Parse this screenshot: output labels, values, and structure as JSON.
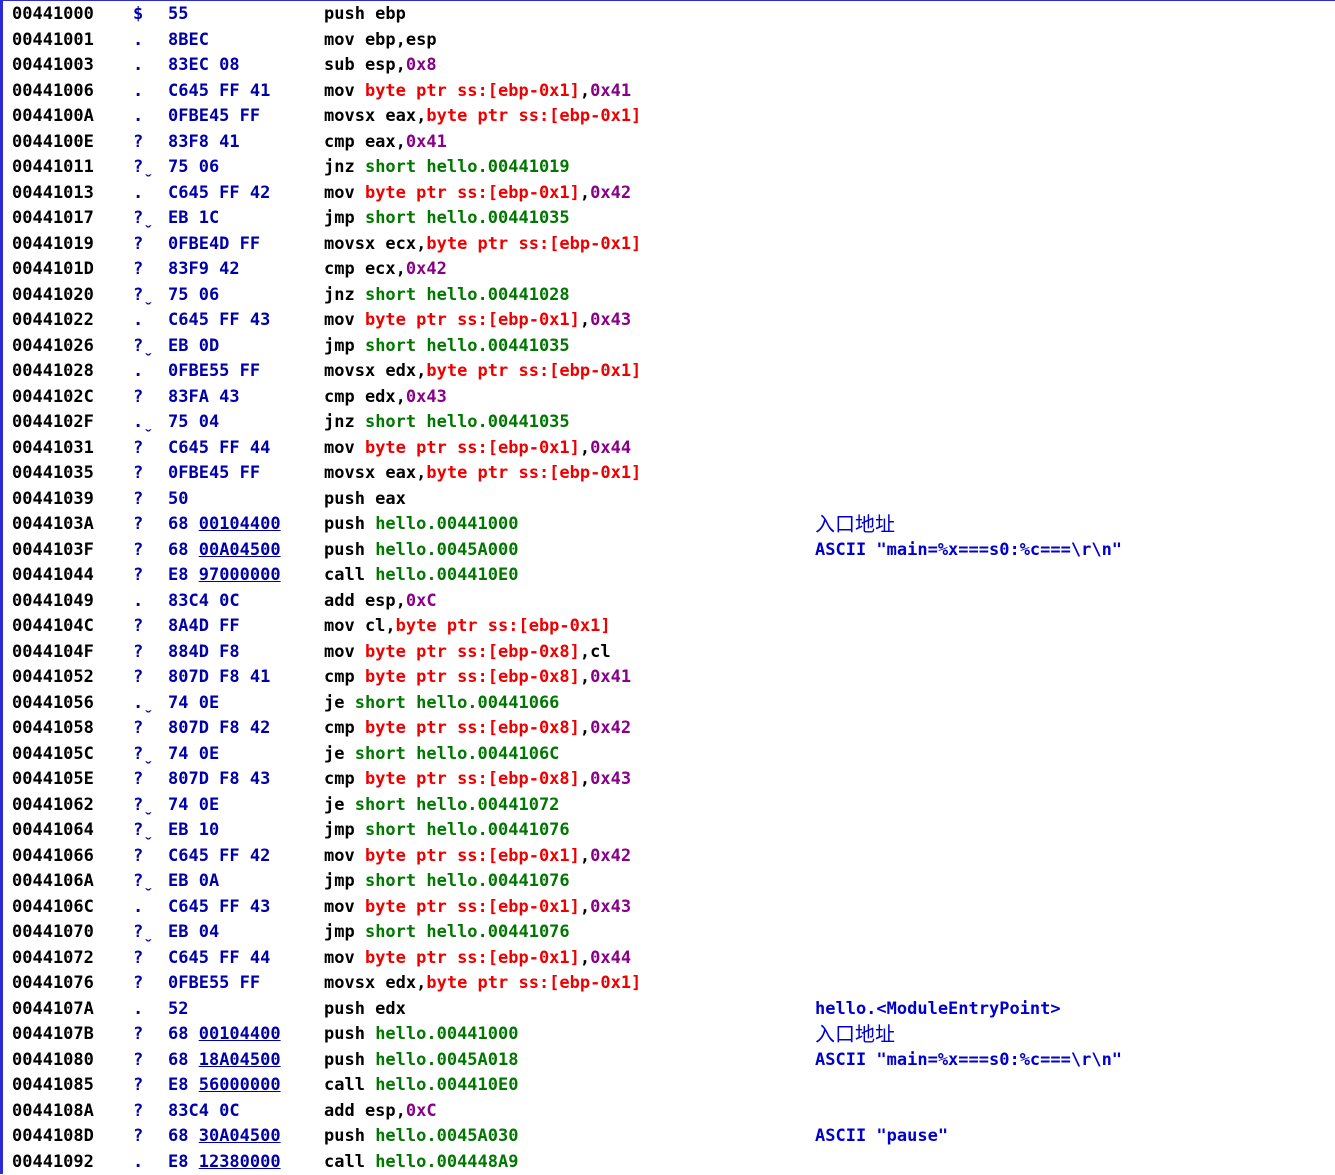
{
  "colors": {
    "address": "#000000",
    "marker": "#0000aa",
    "hex": "#0000aa",
    "mnemonic": "#000000",
    "memory_operand": "#ee0000",
    "immediate": "#880088",
    "jump_target": "#007700",
    "comment": "#0000cc",
    "border": "#2a2ad8"
  },
  "rows": [
    {
      "addr": "00441000",
      "mark": "$",
      "hex": [
        {
          "t": "55"
        }
      ],
      "instr": [
        {
          "t": "push ebp",
          "c": "black"
        }
      ],
      "cmt": ""
    },
    {
      "addr": "00441001",
      "mark": ".",
      "hex": [
        {
          "t": "8BEC"
        }
      ],
      "instr": [
        {
          "t": "mov ebp,esp",
          "c": "black"
        }
      ],
      "cmt": ""
    },
    {
      "addr": "00441003",
      "mark": ".",
      "hex": [
        {
          "t": "83EC 08"
        }
      ],
      "instr": [
        {
          "t": "sub esp,",
          "c": "black"
        },
        {
          "t": "0x8",
          "c": "purple"
        }
      ],
      "cmt": ""
    },
    {
      "addr": "00441006",
      "mark": ".",
      "hex": [
        {
          "t": "C645 FF 41"
        }
      ],
      "instr": [
        {
          "t": "mov ",
          "c": "black"
        },
        {
          "t": "byte ptr ss:[ebp-0x1]",
          "c": "red"
        },
        {
          "t": ",",
          "c": "black"
        },
        {
          "t": "0x41",
          "c": "purple"
        }
      ],
      "cmt": ""
    },
    {
      "addr": "0044100A",
      "mark": ".",
      "hex": [
        {
          "t": "0FBE45 FF"
        }
      ],
      "instr": [
        {
          "t": "movsx eax,",
          "c": "black"
        },
        {
          "t": "byte ptr ss:[ebp-0x1]",
          "c": "red"
        }
      ],
      "cmt": ""
    },
    {
      "addr": "0044100E",
      "mark": "?",
      "hex": [
        {
          "t": "83F8 41"
        }
      ],
      "instr": [
        {
          "t": "cmp eax,",
          "c": "black"
        },
        {
          "t": "0x41",
          "c": "purple"
        }
      ],
      "cmt": ""
    },
    {
      "addr": "00441011",
      "mark": "?ˬ",
      "hex": [
        {
          "t": "75 06"
        }
      ],
      "instr": [
        {
          "t": "jnz ",
          "c": "black"
        },
        {
          "t": "short hello.00441019",
          "c": "green"
        }
      ],
      "cmt": ""
    },
    {
      "addr": "00441013",
      "mark": ".",
      "hex": [
        {
          "t": "C645 FF 42"
        }
      ],
      "instr": [
        {
          "t": "mov ",
          "c": "black"
        },
        {
          "t": "byte ptr ss:[ebp-0x1]",
          "c": "red"
        },
        {
          "t": ",",
          "c": "black"
        },
        {
          "t": "0x42",
          "c": "purple"
        }
      ],
      "cmt": ""
    },
    {
      "addr": "00441017",
      "mark": "?ˬ",
      "hex": [
        {
          "t": "EB 1C"
        }
      ],
      "instr": [
        {
          "t": "jmp ",
          "c": "black"
        },
        {
          "t": "short hello.00441035",
          "c": "green"
        }
      ],
      "cmt": ""
    },
    {
      "addr": "00441019",
      "mark": "?",
      "hex": [
        {
          "t": "0FBE4D FF"
        }
      ],
      "instr": [
        {
          "t": "movsx ecx,",
          "c": "black"
        },
        {
          "t": "byte ptr ss:[ebp-0x1]",
          "c": "red"
        }
      ],
      "cmt": ""
    },
    {
      "addr": "0044101D",
      "mark": "?",
      "hex": [
        {
          "t": "83F9 42"
        }
      ],
      "instr": [
        {
          "t": "cmp ecx,",
          "c": "black"
        },
        {
          "t": "0x42",
          "c": "purple"
        }
      ],
      "cmt": ""
    },
    {
      "addr": "00441020",
      "mark": "?ˬ",
      "hex": [
        {
          "t": "75 06"
        }
      ],
      "instr": [
        {
          "t": "jnz ",
          "c": "black"
        },
        {
          "t": "short hello.00441028",
          "c": "green"
        }
      ],
      "cmt": ""
    },
    {
      "addr": "00441022",
      "mark": ".",
      "hex": [
        {
          "t": "C645 FF 43"
        }
      ],
      "instr": [
        {
          "t": "mov ",
          "c": "black"
        },
        {
          "t": "byte ptr ss:[ebp-0x1]",
          "c": "red"
        },
        {
          "t": ",",
          "c": "black"
        },
        {
          "t": "0x43",
          "c": "purple"
        }
      ],
      "cmt": ""
    },
    {
      "addr": "00441026",
      "mark": "?ˬ",
      "hex": [
        {
          "t": "EB 0D"
        }
      ],
      "instr": [
        {
          "t": "jmp ",
          "c": "black"
        },
        {
          "t": "short hello.00441035",
          "c": "green"
        }
      ],
      "cmt": ""
    },
    {
      "addr": "00441028",
      "mark": ".",
      "hex": [
        {
          "t": "0FBE55 FF"
        }
      ],
      "instr": [
        {
          "t": "movsx edx,",
          "c": "black"
        },
        {
          "t": "byte ptr ss:[ebp-0x1]",
          "c": "red"
        }
      ],
      "cmt": ""
    },
    {
      "addr": "0044102C",
      "mark": "?",
      "hex": [
        {
          "t": "83FA 43"
        }
      ],
      "instr": [
        {
          "t": "cmp edx,",
          "c": "black"
        },
        {
          "t": "0x43",
          "c": "purple"
        }
      ],
      "cmt": ""
    },
    {
      "addr": "0044102F",
      "mark": ".ˬ",
      "hex": [
        {
          "t": "75 04"
        }
      ],
      "instr": [
        {
          "t": "jnz ",
          "c": "black"
        },
        {
          "t": "short hello.00441035",
          "c": "green"
        }
      ],
      "cmt": ""
    },
    {
      "addr": "00441031",
      "mark": "?",
      "hex": [
        {
          "t": "C645 FF 44"
        }
      ],
      "instr": [
        {
          "t": "mov ",
          "c": "black"
        },
        {
          "t": "byte ptr ss:[ebp-0x1]",
          "c": "red"
        },
        {
          "t": ",",
          "c": "black"
        },
        {
          "t": "0x44",
          "c": "purple"
        }
      ],
      "cmt": ""
    },
    {
      "addr": "00441035",
      "mark": "?",
      "hex": [
        {
          "t": "0FBE45 FF"
        }
      ],
      "instr": [
        {
          "t": "movsx eax,",
          "c": "black"
        },
        {
          "t": "byte ptr ss:[ebp-0x1]",
          "c": "red"
        }
      ],
      "cmt": ""
    },
    {
      "addr": "00441039",
      "mark": "?",
      "hex": [
        {
          "t": "50"
        }
      ],
      "instr": [
        {
          "t": "push eax",
          "c": "black"
        }
      ],
      "cmt": ""
    },
    {
      "addr": "0044103A",
      "mark": "?",
      "hex": [
        {
          "t": "68 "
        },
        {
          "t": "00104400",
          "u": true
        }
      ],
      "instr": [
        {
          "t": "push ",
          "c": "black"
        },
        {
          "t": "hello.00441000",
          "c": "green"
        }
      ],
      "cmt": "入口地址",
      "cjk": true
    },
    {
      "addr": "0044103F",
      "mark": "?",
      "hex": [
        {
          "t": "68 "
        },
        {
          "t": "00A04500",
          "u": true
        }
      ],
      "instr": [
        {
          "t": "push ",
          "c": "black"
        },
        {
          "t": "hello.0045A000",
          "c": "green"
        }
      ],
      "cmt": "ASCII \"main=%x===s0:%c===\\r\\n\""
    },
    {
      "addr": "00441044",
      "mark": "?",
      "hex": [
        {
          "t": "E8 "
        },
        {
          "t": "97000000",
          "u": true
        }
      ],
      "instr": [
        {
          "t": "call ",
          "c": "black"
        },
        {
          "t": "hello.004410E0",
          "c": "green"
        }
      ],
      "cmt": ""
    },
    {
      "addr": "00441049",
      "mark": ".",
      "hex": [
        {
          "t": "83C4 0C"
        }
      ],
      "instr": [
        {
          "t": "add esp,",
          "c": "black"
        },
        {
          "t": "0xC",
          "c": "purple"
        }
      ],
      "cmt": ""
    },
    {
      "addr": "0044104C",
      "mark": "?",
      "hex": [
        {
          "t": "8A4D FF"
        }
      ],
      "instr": [
        {
          "t": "mov cl,",
          "c": "black"
        },
        {
          "t": "byte ptr ss:[ebp-0x1]",
          "c": "red"
        }
      ],
      "cmt": ""
    },
    {
      "addr": "0044104F",
      "mark": "?",
      "hex": [
        {
          "t": "884D F8"
        }
      ],
      "instr": [
        {
          "t": "mov ",
          "c": "black"
        },
        {
          "t": "byte ptr ss:[ebp-0x8]",
          "c": "red"
        },
        {
          "t": ",cl",
          "c": "black"
        }
      ],
      "cmt": ""
    },
    {
      "addr": "00441052",
      "mark": "?",
      "hex": [
        {
          "t": "807D F8 41"
        }
      ],
      "instr": [
        {
          "t": "cmp ",
          "c": "black"
        },
        {
          "t": "byte ptr ss:[ebp-0x8]",
          "c": "red"
        },
        {
          "t": ",",
          "c": "black"
        },
        {
          "t": "0x41",
          "c": "purple"
        }
      ],
      "cmt": ""
    },
    {
      "addr": "00441056",
      "mark": ".ˬ",
      "hex": [
        {
          "t": "74 0E"
        }
      ],
      "instr": [
        {
          "t": "je ",
          "c": "black"
        },
        {
          "t": "short hello.00441066",
          "c": "green"
        }
      ],
      "cmt": ""
    },
    {
      "addr": "00441058",
      "mark": "?",
      "hex": [
        {
          "t": "807D F8 42"
        }
      ],
      "instr": [
        {
          "t": "cmp ",
          "c": "black"
        },
        {
          "t": "byte ptr ss:[ebp-0x8]",
          "c": "red"
        },
        {
          "t": ",",
          "c": "black"
        },
        {
          "t": "0x42",
          "c": "purple"
        }
      ],
      "cmt": ""
    },
    {
      "addr": "0044105C",
      "mark": "?ˬ",
      "hex": [
        {
          "t": "74 0E"
        }
      ],
      "instr": [
        {
          "t": "je ",
          "c": "black"
        },
        {
          "t": "short hello.0044106C",
          "c": "green"
        }
      ],
      "cmt": ""
    },
    {
      "addr": "0044105E",
      "mark": "?",
      "hex": [
        {
          "t": "807D F8 43"
        }
      ],
      "instr": [
        {
          "t": "cmp ",
          "c": "black"
        },
        {
          "t": "byte ptr ss:[ebp-0x8]",
          "c": "red"
        },
        {
          "t": ",",
          "c": "black"
        },
        {
          "t": "0x43",
          "c": "purple"
        }
      ],
      "cmt": ""
    },
    {
      "addr": "00441062",
      "mark": "?ˬ",
      "hex": [
        {
          "t": "74 0E"
        }
      ],
      "instr": [
        {
          "t": "je ",
          "c": "black"
        },
        {
          "t": "short hello.00441072",
          "c": "green"
        }
      ],
      "cmt": ""
    },
    {
      "addr": "00441064",
      "mark": "?ˬ",
      "hex": [
        {
          "t": "EB 10"
        }
      ],
      "instr": [
        {
          "t": "jmp ",
          "c": "black"
        },
        {
          "t": "short hello.00441076",
          "c": "green"
        }
      ],
      "cmt": ""
    },
    {
      "addr": "00441066",
      "mark": "?",
      "hex": [
        {
          "t": "C645 FF 42"
        }
      ],
      "instr": [
        {
          "t": "mov ",
          "c": "black"
        },
        {
          "t": "byte ptr ss:[ebp-0x1]",
          "c": "red"
        },
        {
          "t": ",",
          "c": "black"
        },
        {
          "t": "0x42",
          "c": "purple"
        }
      ],
      "cmt": ""
    },
    {
      "addr": "0044106A",
      "mark": "?ˬ",
      "hex": [
        {
          "t": "EB 0A"
        }
      ],
      "instr": [
        {
          "t": "jmp ",
          "c": "black"
        },
        {
          "t": "short hello.00441076",
          "c": "green"
        }
      ],
      "cmt": ""
    },
    {
      "addr": "0044106C",
      "mark": ".",
      "hex": [
        {
          "t": "C645 FF 43"
        }
      ],
      "instr": [
        {
          "t": "mov ",
          "c": "black"
        },
        {
          "t": "byte ptr ss:[ebp-0x1]",
          "c": "red"
        },
        {
          "t": ",",
          "c": "black"
        },
        {
          "t": "0x43",
          "c": "purple"
        }
      ],
      "cmt": ""
    },
    {
      "addr": "00441070",
      "mark": "?ˬ",
      "hex": [
        {
          "t": "EB 04"
        }
      ],
      "instr": [
        {
          "t": "jmp ",
          "c": "black"
        },
        {
          "t": "short hello.00441076",
          "c": "green"
        }
      ],
      "cmt": ""
    },
    {
      "addr": "00441072",
      "mark": "?",
      "hex": [
        {
          "t": "C645 FF 44"
        }
      ],
      "instr": [
        {
          "t": "mov ",
          "c": "black"
        },
        {
          "t": "byte ptr ss:[ebp-0x1]",
          "c": "red"
        },
        {
          "t": ",",
          "c": "black"
        },
        {
          "t": "0x44",
          "c": "purple"
        }
      ],
      "cmt": ""
    },
    {
      "addr": "00441076",
      "mark": "?",
      "hex": [
        {
          "t": "0FBE55 FF"
        }
      ],
      "instr": [
        {
          "t": "movsx edx,",
          "c": "black"
        },
        {
          "t": "byte ptr ss:[ebp-0x1]",
          "c": "red"
        }
      ],
      "cmt": ""
    },
    {
      "addr": "0044107A",
      "mark": ".",
      "hex": [
        {
          "t": "52"
        }
      ],
      "instr": [
        {
          "t": "push edx",
          "c": "black"
        }
      ],
      "cmt": "hello.<ModuleEntryPoint>"
    },
    {
      "addr": "0044107B",
      "mark": "?",
      "hex": [
        {
          "t": "68 "
        },
        {
          "t": "00104400",
          "u": true
        }
      ],
      "instr": [
        {
          "t": "push ",
          "c": "black"
        },
        {
          "t": "hello.00441000",
          "c": "green"
        }
      ],
      "cmt": "入口地址",
      "cjk": true
    },
    {
      "addr": "00441080",
      "mark": "?",
      "hex": [
        {
          "t": "68 "
        },
        {
          "t": "18A04500",
          "u": true
        }
      ],
      "instr": [
        {
          "t": "push ",
          "c": "black"
        },
        {
          "t": "hello.0045A018",
          "c": "green"
        }
      ],
      "cmt": "ASCII \"main=%x===s0:%c===\\r\\n\""
    },
    {
      "addr": "00441085",
      "mark": "?",
      "hex": [
        {
          "t": "E8 "
        },
        {
          "t": "56000000",
          "u": true
        }
      ],
      "instr": [
        {
          "t": "call ",
          "c": "black"
        },
        {
          "t": "hello.004410E0",
          "c": "green"
        }
      ],
      "cmt": ""
    },
    {
      "addr": "0044108A",
      "mark": "?",
      "hex": [
        {
          "t": "83C4 0C"
        }
      ],
      "instr": [
        {
          "t": "add esp,",
          "c": "black"
        },
        {
          "t": "0xC",
          "c": "purple"
        }
      ],
      "cmt": ""
    },
    {
      "addr": "0044108D",
      "mark": "?",
      "hex": [
        {
          "t": "68 "
        },
        {
          "t": "30A04500",
          "u": true
        }
      ],
      "instr": [
        {
          "t": "push ",
          "c": "black"
        },
        {
          "t": "hello.0045A030",
          "c": "green"
        }
      ],
      "cmt": "ASCII \"pause\""
    },
    {
      "addr": "00441092",
      "mark": ".",
      "hex": [
        {
          "t": "E8 "
        },
        {
          "t": "12380000",
          "u": true
        }
      ],
      "instr": [
        {
          "t": "call ",
          "c": "black"
        },
        {
          "t": "hello.004448A9",
          "c": "green"
        }
      ],
      "cmt": ""
    }
  ]
}
